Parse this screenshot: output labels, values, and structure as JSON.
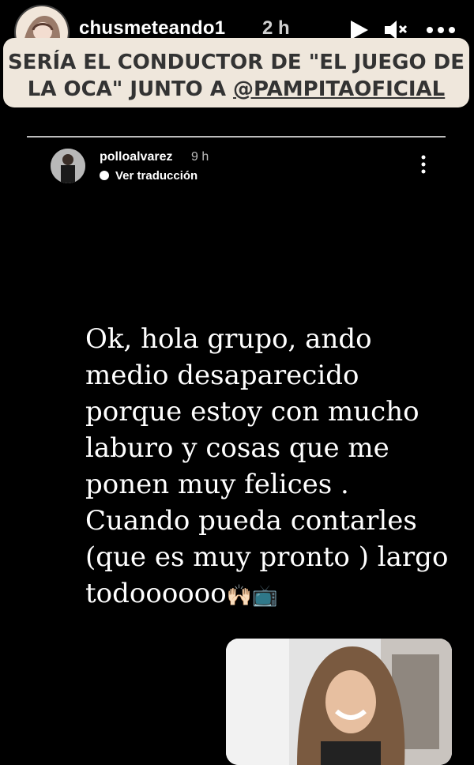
{
  "story": {
    "username": "chusmeteando1",
    "time": "2 h",
    "headline_part1": "SERÍA EL CONDUCTOR DE \"EL JUEGO DE LA OCA\" JUNTO A ",
    "headline_mention": "@PAMPITAOFICIAL"
  },
  "repost": {
    "username": "polloalvarez",
    "time": "9 h",
    "translate_label": "Ver traducción"
  },
  "post": {
    "text": "Ok, hola grupo, ando medio desaparecido porque estoy con mucho laburo y cosas que me ponen muy felices . Cuando pueda contarles (que es muy pronto ) largo todoooooo",
    "emoji_hands": "🙌🏻",
    "emoji_tv": "📺"
  }
}
